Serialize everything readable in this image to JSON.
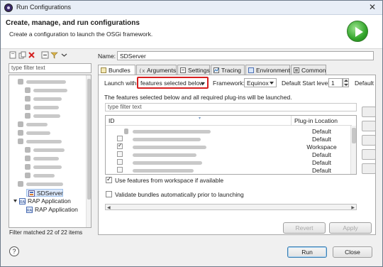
{
  "window": {
    "title": "Run Configurations"
  },
  "header": {
    "title": "Create, manage, and run configurations",
    "subtitle": "Create a configuration to launch the OSGi framework."
  },
  "left": {
    "filter_placeholder": "type filter text",
    "tree": {
      "selected_item": "SDServer",
      "items": [
        {
          "label": "RAP Application",
          "kind": "group"
        },
        {
          "label": "RAP Application",
          "kind": "child"
        }
      ]
    },
    "status": "Filter matched 22 of 22 items"
  },
  "main": {
    "name_label": "Name:",
    "name_value": "SDServer",
    "tabs": [
      {
        "label": "Bundles",
        "active": true
      },
      {
        "label": "Arguments"
      },
      {
        "label": "Settings"
      },
      {
        "label": "Tracing"
      },
      {
        "label": "Environment"
      },
      {
        "label": "Common"
      }
    ],
    "launch_with_label": "Launch with:",
    "launch_with_value": "features selected below",
    "framework_label": "Framework:",
    "framework_value": "Equinox",
    "default_start_level_label": "Default Start level:",
    "default_start_level_value": "1",
    "default_label": "Default",
    "description": "The features selected below and all required plug-ins will be launched.",
    "feature_filter_placeholder": "type filter text",
    "columns": {
      "id": "ID",
      "location": "Plug-in Location"
    },
    "rows": [
      {
        "checked": false,
        "location": "Default"
      },
      {
        "checked": false,
        "location": "Default"
      },
      {
        "checked": true,
        "location": "Workspace"
      },
      {
        "checked": false,
        "location": "Default"
      },
      {
        "checked": false,
        "location": "Default"
      },
      {
        "checked": false,
        "location": "Default"
      }
    ],
    "use_workspace_label": "Use features from workspace if available",
    "use_workspace_checked": true,
    "validate_label": "Validate bundles automatically prior to launching",
    "validate_checked": false
  },
  "buttons": {
    "revert": "Revert",
    "apply": "Apply",
    "run": "Run",
    "close": "Close",
    "help": "?"
  },
  "colors": {
    "highlight": "#d61f1f",
    "selection": "#dce9fb",
    "run_badge": "#33a52b"
  }
}
